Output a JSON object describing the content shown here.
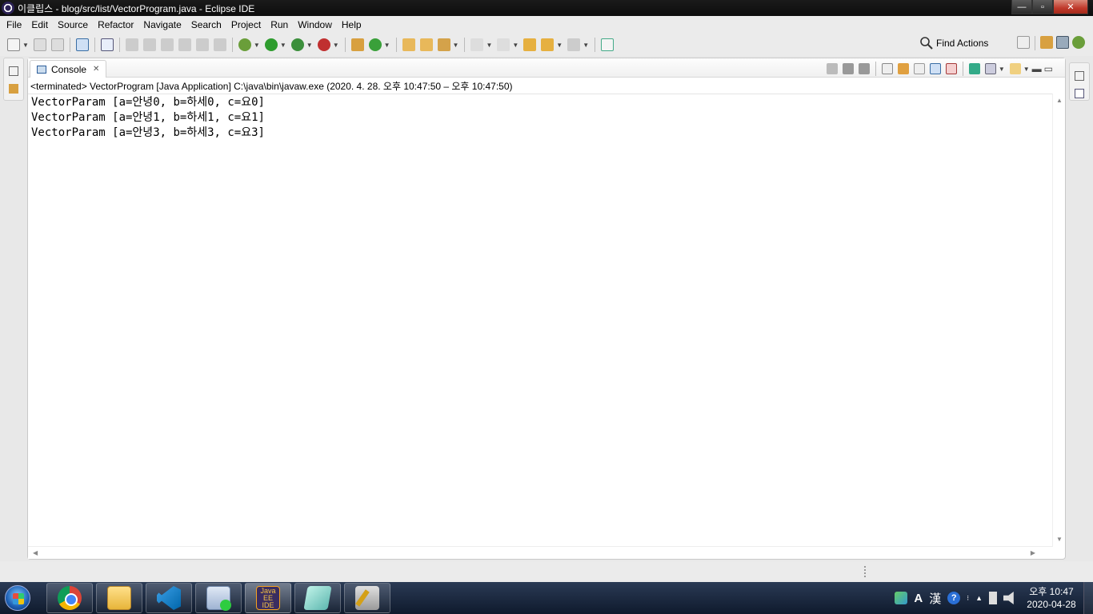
{
  "window": {
    "title": "이클립스 - blog/src/list/VectorProgram.java - Eclipse IDE",
    "minimize": "—",
    "maximize": "▫",
    "close": "✕"
  },
  "menu": [
    "File",
    "Edit",
    "Source",
    "Refactor",
    "Navigate",
    "Search",
    "Project",
    "Run",
    "Window",
    "Help"
  ],
  "toolbar": {
    "find_actions_label": "Find Actions"
  },
  "console_view": {
    "tab_label": "Console",
    "tab_close": "✕",
    "header": "<terminated> VectorProgram [Java Application] C:\\java\\bin\\javaw.exe  (2020. 4. 28. 오후 10:47:50 – 오후 10:47:50)",
    "lines": [
      "VectorParam [a=안녕0, b=하세0, c=요0]",
      "VectorParam [a=안녕1, b=하세1, c=요1]",
      "VectorParam [a=안녕3, b=하세3, c=요3]"
    ]
  },
  "taskbar": {
    "apps": [
      {
        "name": "chrome-icon",
        "label": ""
      },
      {
        "name": "file-explorer-icon",
        "label": ""
      },
      {
        "name": "vscode-icon",
        "label": ""
      },
      {
        "name": "app-runner-icon",
        "label": ""
      },
      {
        "name": "eclipse-icon",
        "label": "Java EE IDE"
      },
      {
        "name": "notepad-icon",
        "label": ""
      },
      {
        "name": "tools-icon",
        "label": ""
      }
    ],
    "ime_mode": "A",
    "ime_hanja": "漢",
    "help": "?",
    "time": "오후 10:47",
    "date": "2020-04-28"
  },
  "colors": {
    "title_bar": "#111111",
    "console_bg": "#ffffff",
    "taskbar": "#1b2a40"
  }
}
